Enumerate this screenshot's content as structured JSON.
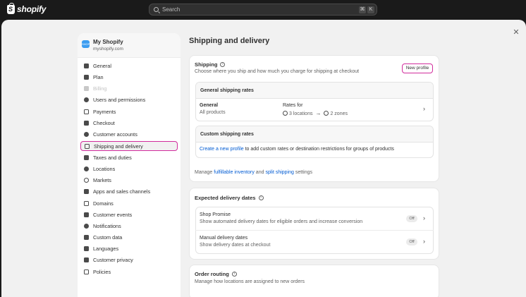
{
  "topbar": {
    "brand": "shopify",
    "search_placeholder": "Search",
    "kbd": [
      "⌘",
      "K"
    ]
  },
  "modal": {
    "close": "✕"
  },
  "sidebar": {
    "store_name": "My Shopify",
    "store_domain": "myshopify.com",
    "items": [
      {
        "label": "General",
        "icon": "store-icon"
      },
      {
        "label": "Plan",
        "icon": "plan-icon"
      },
      {
        "label": "Billing",
        "icon": "billing-icon",
        "disabled": true
      },
      {
        "label": "Users and permissions",
        "icon": "users-icon"
      },
      {
        "label": "Payments",
        "icon": "payments-icon"
      },
      {
        "label": "Checkout",
        "icon": "cart-icon"
      },
      {
        "label": "Customer accounts",
        "icon": "person-icon"
      },
      {
        "label": "Shipping and delivery",
        "icon": "truck-icon",
        "active": true
      },
      {
        "label": "Taxes and duties",
        "icon": "tax-icon"
      },
      {
        "label": "Locations",
        "icon": "location-icon"
      },
      {
        "label": "Markets",
        "icon": "globe-icon"
      },
      {
        "label": "Apps and sales channels",
        "icon": "apps-icon"
      },
      {
        "label": "Domains",
        "icon": "domains-icon"
      },
      {
        "label": "Customer events",
        "icon": "events-icon"
      },
      {
        "label": "Notifications",
        "icon": "bell-icon"
      },
      {
        "label": "Custom data",
        "icon": "data-icon"
      },
      {
        "label": "Languages",
        "icon": "language-icon"
      },
      {
        "label": "Customer privacy",
        "icon": "lock-icon"
      },
      {
        "label": "Policies",
        "icon": "policies-icon"
      }
    ]
  },
  "main": {
    "title": "Shipping and delivery",
    "shipping": {
      "title": "Shipping",
      "subtitle": "Choose where you ship and how much you charge for shipping at checkout",
      "new_profile": "New profile",
      "general_rates_header": "General shipping rates",
      "general_name": "General",
      "general_scope": "All products",
      "rates_for": "Rates for",
      "locations": "3 locations",
      "zones": "2 zones",
      "custom_rates_header": "Custom shipping rates",
      "custom_link": "Create a new profile",
      "custom_text": "to add custom rates or destination restrictions for groups of products",
      "manage_prefix": "Manage",
      "manage_link1": "fulfillable inventory",
      "manage_and": "and",
      "manage_link2": "split shipping",
      "manage_suffix": "settings"
    },
    "expected": {
      "title": "Expected delivery dates",
      "items": [
        {
          "title": "Shop Promise",
          "desc": "Show automated delivery dates for eligible orders and increase conversion",
          "status": "Off"
        },
        {
          "title": "Manual delivery dates",
          "desc": "Show delivery dates at checkout",
          "status": "Off"
        }
      ]
    },
    "routing": {
      "title": "Order routing",
      "subtitle": "Manage how locations are assigned to new orders"
    }
  }
}
